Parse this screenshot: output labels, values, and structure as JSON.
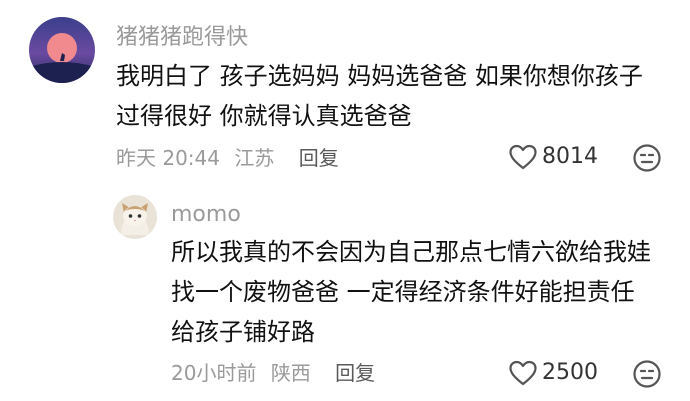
{
  "comments": [
    {
      "username": "猪猪猪跑得快",
      "content_lines": [
        "我明白了 孩子选妈妈 妈妈选爸爸 如果你想你孩子",
        "过得很好 你就得认真选爸爸"
      ],
      "time": "昨天 20:44",
      "location": "江苏",
      "reply_label": "回复",
      "like_count": "8014",
      "avatar_icon": "moon-silhouette-avatar"
    },
    {
      "username": "momo",
      "content_lines": [
        "所以我真的不会因为自己那点七情六欲给我娃",
        "找一个废物爸爸 一定得经济条件好能担责任",
        "给孩子铺好路"
      ],
      "time": "20小时前",
      "location": "陕西",
      "reply_label": "回复",
      "like_count": "2500",
      "avatar_icon": "cat-avatar"
    }
  ],
  "icons": {
    "like": "heart-outline-icon",
    "react": "meh-face-icon"
  }
}
